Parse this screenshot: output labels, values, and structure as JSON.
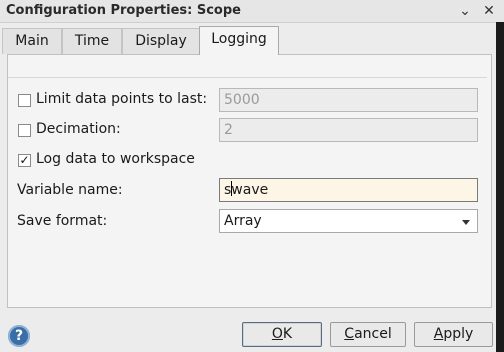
{
  "window": {
    "title": "Configuration Properties: Scope",
    "minimize_glyph": "⌄",
    "close_glyph": "✕"
  },
  "tabs": [
    {
      "label": "Main",
      "active": false
    },
    {
      "label": "Time",
      "active": false
    },
    {
      "label": "Display",
      "active": false
    },
    {
      "label": "Logging",
      "active": true
    }
  ],
  "logging": {
    "limit_points": {
      "label": "Limit data points to last:",
      "checked": false,
      "value": "5000",
      "enabled": false
    },
    "decimation": {
      "label": "Decimation:",
      "checked": false,
      "value": "2",
      "enabled": false
    },
    "log_to_workspace": {
      "label": "Log data to workspace",
      "checked": true,
      "check_glyph": "✓"
    },
    "variable_name": {
      "label": "Variable name:",
      "value_before_caret": "s",
      "value_after_caret": "wave"
    },
    "save_format": {
      "label": "Save format:",
      "value": "Array"
    }
  },
  "footer": {
    "help_glyph": "?",
    "ok": {
      "label": "OK",
      "mnemonic": "O",
      "rest": "K"
    },
    "cancel": {
      "label": "Cancel",
      "mnemonic": "C",
      "rest": "ancel"
    },
    "apply": {
      "label": "Apply",
      "mnemonic": "A",
      "rest": "pply"
    }
  },
  "colors": {
    "active_field_bg": "#fdf6e7",
    "help_icon": "#3a6ea8"
  }
}
